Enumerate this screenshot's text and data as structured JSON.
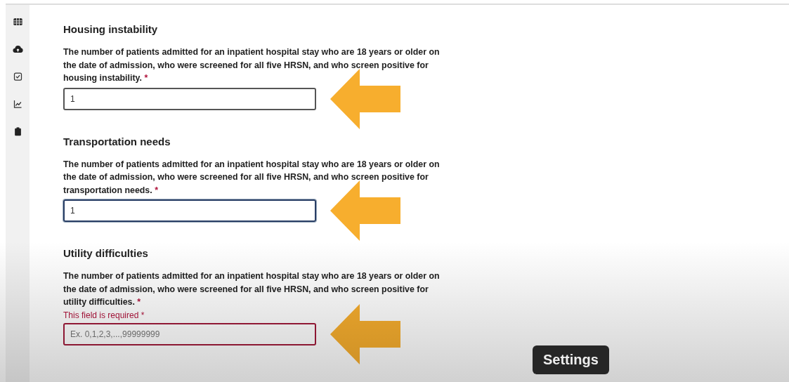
{
  "sidebar": {
    "items": [
      {
        "kind": "table"
      },
      {
        "kind": "cloud"
      },
      {
        "kind": "check"
      },
      {
        "kind": "chart"
      },
      {
        "kind": "clipboard"
      }
    ]
  },
  "sections": [
    {
      "title": "Housing instability",
      "question": "The number of patients admitted for an inpatient hospital stay who are 18 years or older on the date of admission, who were screened for all five HRSN, and who screen positive for housing instability.",
      "required": "*",
      "value": "1",
      "focused": false
    },
    {
      "title": "Transportation needs",
      "question": "The number of patients admitted for an inpatient hospital stay who are 18 years or older on the date of admission, who were screened for all five HRSN, and who screen positive for transportation needs.",
      "required": "*",
      "value": "1",
      "focused": true
    },
    {
      "title": "Utility difficulties",
      "question": "The number of patients admitted for an inpatient hospital stay who are 18 years or older on the date of admission, who were screened for all five HRSN, and who screen positive for utility difficulties.",
      "required": "*",
      "error": "This field is required",
      "error_mark": "*",
      "placeholder": "Ex. 0,1,2,3,...,99999999",
      "focused": false
    }
  ],
  "tooltip": "Settings"
}
